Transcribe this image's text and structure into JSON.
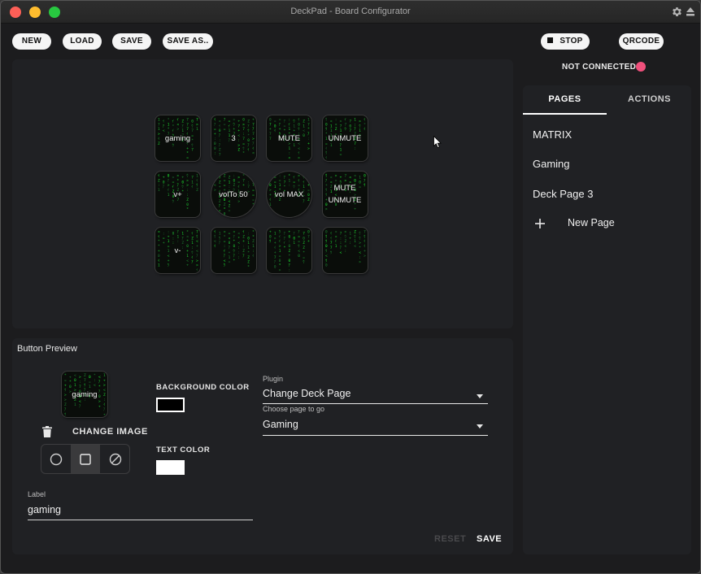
{
  "window": {
    "title": "DeckPad - Board Configurator"
  },
  "toolbar": {
    "new": "NEW",
    "load": "LOAD",
    "save": "SAVE",
    "save_as": "SAVE AS.."
  },
  "server": {
    "stop": "STOP",
    "qrcode": "QRCODE",
    "status": "NOT CONNECTED",
    "status_color": "#f0507c"
  },
  "deck": {
    "keys": [
      {
        "label": "gaming",
        "shape": "square"
      },
      {
        "label": "3",
        "shape": "square"
      },
      {
        "label": "MUTE",
        "shape": "square"
      },
      {
        "label": "UNMUTE",
        "shape": "square"
      },
      {
        "label": "v+",
        "shape": "square"
      },
      {
        "label": "volTo 50",
        "shape": "round"
      },
      {
        "label": "vol MAX",
        "shape": "round"
      },
      {
        "label": "MUTE\nUNMUTE",
        "shape": "square"
      },
      {
        "label": "v-",
        "shape": "square"
      },
      {
        "label": "",
        "shape": "square"
      },
      {
        "label": "",
        "shape": "square"
      },
      {
        "label": "",
        "shape": "square"
      }
    ]
  },
  "sidebar": {
    "tabs": [
      {
        "label": "PAGES",
        "active": true
      },
      {
        "label": "ACTIONS",
        "active": false
      }
    ],
    "pages": [
      "MATRIX",
      "Gaming",
      "Deck Page 3"
    ],
    "new_page": "New Page"
  },
  "preview": {
    "title": "Button Preview",
    "button_label": "gaming",
    "change_image": "CHANGE IMAGE",
    "background_color_label": "BACKGROUND COLOR",
    "background_color": "#000000",
    "text_color_label": "TEXT COLOR",
    "text_color": "#ffffff",
    "selected_shape": "square",
    "label_caption": "Label",
    "label_value": "gaming",
    "plugin_caption": "Plugin",
    "plugin_value": "Change Deck Page",
    "page_caption": "Choose page to go",
    "page_value": "Gaming",
    "reset": "RESET",
    "save": "SAVE"
  },
  "icons": [
    "gear-icon",
    "eject-icon",
    "stop-icon",
    "plus-icon",
    "trash-icon",
    "circle-shape-icon",
    "square-shape-icon",
    "no-shape-icon",
    "mouse-cursor-icon"
  ],
  "colors": {
    "background": "#1c1c1e",
    "panel": "#202124",
    "matrix_green": "#2fd34a",
    "accent_pink": "#f0507c"
  }
}
